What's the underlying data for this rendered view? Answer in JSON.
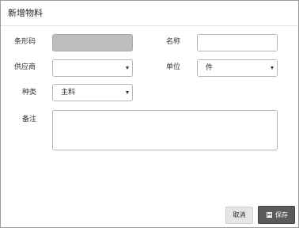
{
  "dialog": {
    "title": "新增物料"
  },
  "form": {
    "barcode": {
      "label": "条形码",
      "value": ""
    },
    "name": {
      "label": "名称",
      "value": ""
    },
    "supplier": {
      "label": "供应商",
      "value": ""
    },
    "unit": {
      "label": "单位",
      "value": "件"
    },
    "category": {
      "label": "种类",
      "value": "主料"
    },
    "remark": {
      "label": "备注",
      "value": ""
    }
  },
  "footer": {
    "cancel_label": "取消",
    "save_label": "保存"
  },
  "icons": {
    "dropdown": "chevron-down-icon",
    "save": "save-icon"
  },
  "colors": {
    "save_button_bg": "#5a5a5a",
    "cancel_button_bg": "#e6e6e6",
    "disabled_input_bg": "#bdbdbd"
  }
}
